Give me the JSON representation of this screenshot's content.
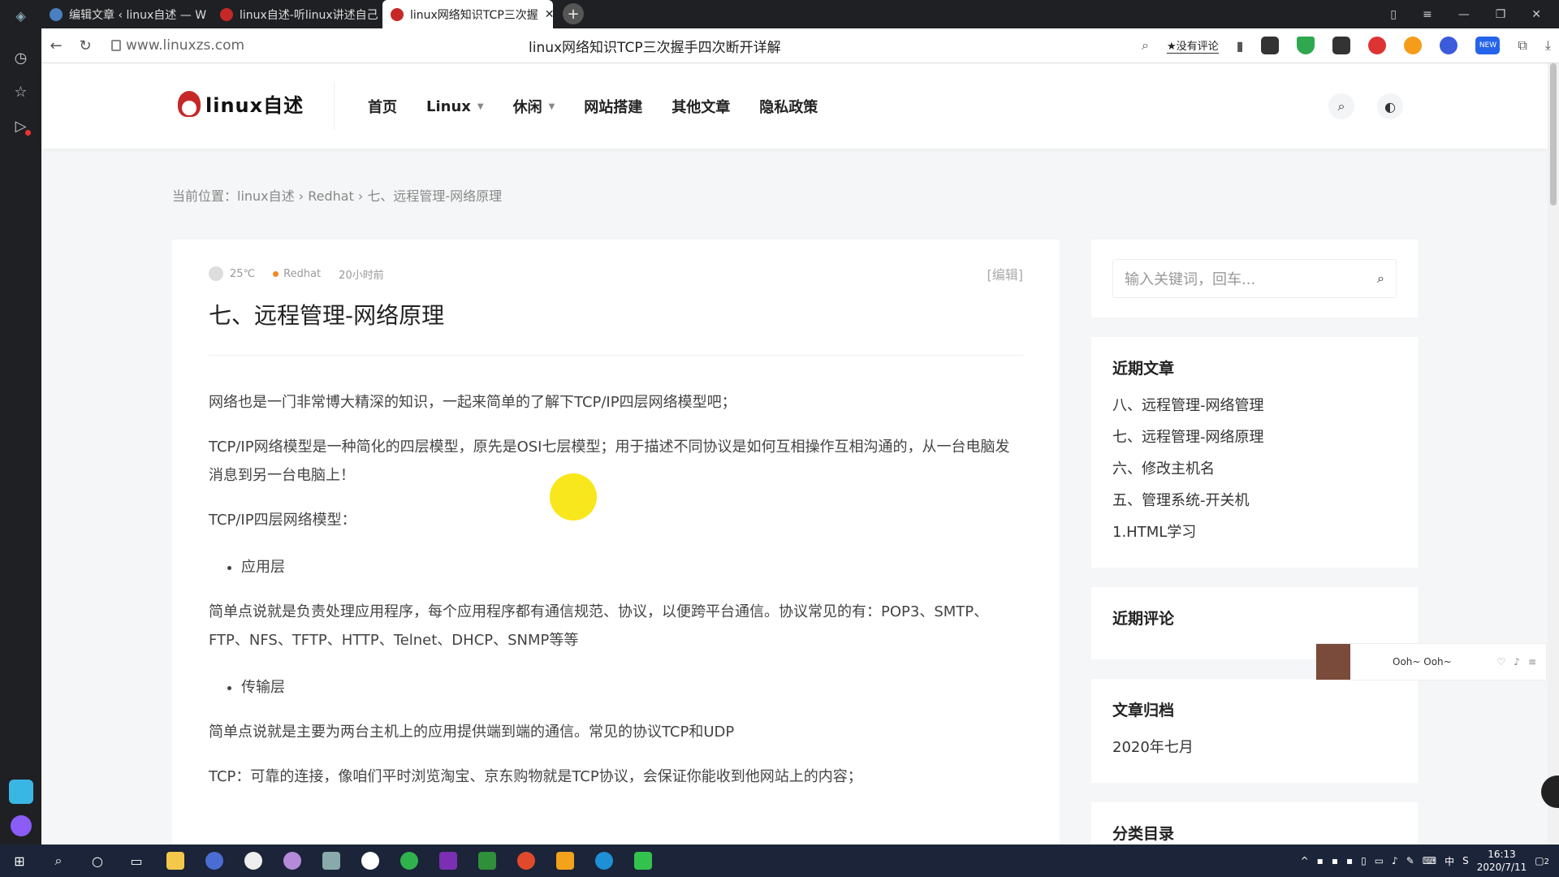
{
  "browser": {
    "tabs": [
      {
        "label": "编辑文章 ‹ linux自述 — W",
        "active": false
      },
      {
        "label": "linux自述-听linux讲述自己",
        "active": false
      },
      {
        "label": "linux网络知识TCP三次握",
        "active": true
      }
    ],
    "url": "www.linuxzs.com",
    "page_title": "linux网络知识TCP三次握手四次断开详解",
    "comment_button": "★没有评论",
    "new_badge": "NEW"
  },
  "site": {
    "logo_text": "linux自述",
    "nav": [
      {
        "label": "首页",
        "dropdown": false
      },
      {
        "label": "Linux",
        "dropdown": true
      },
      {
        "label": "休闲",
        "dropdown": true
      },
      {
        "label": "网站搭建",
        "dropdown": false
      },
      {
        "label": "其他文章",
        "dropdown": false
      },
      {
        "label": "隐私政策",
        "dropdown": false
      }
    ]
  },
  "breadcrumb": "当前位置：linux自述 › Redhat › 七、远程管理-网络原理",
  "article": {
    "author": "25℃",
    "category": "Redhat",
    "time": "20小时前",
    "edit": "[编辑]",
    "title": "七、远程管理-网络原理",
    "p1": "网络也是一门非常博大精深的知识，一起来简单的了解下TCP/IP四层网络模型吧；",
    "p2": "TCP/IP网络模型是一种简化的四层模型，原先是OSI七层模型；用于描述不同协议是如何互相操作互相沟通的，从一台电脑发消息到另一台电脑上！",
    "p3": "TCP/IP四层网络模型：",
    "li1": "应用层",
    "p4": "简单点说就是负责处理应用程序，每个应用程序都有通信规范、协议，以便跨平台通信。协议常见的有：POP3、SMTP、FTP、NFS、TFTP、HTTP、Telnet、DHCP、SNMP等等",
    "li2": "传输层",
    "p5": "简单点说就是主要为两台主机上的应用提供端到端的通信。常见的协议TCP和UDP",
    "p6": "TCP：可靠的连接，像咱们平时浏览淘宝、京东购物就是TCP协议，会保证你能收到他网站上的内容；"
  },
  "sidebar": {
    "search_placeholder": "输入关键词，回车...",
    "recent_posts_title": "近期文章",
    "recent_posts": [
      "八、远程管理-网络管理",
      "七、远程管理-网络原理",
      "六、修改主机名",
      "五、管理系统-开关机",
      "1.HTML学习"
    ],
    "recent_comments_title": "近期评论",
    "archives_title": "文章归档",
    "archives": [
      "2020年七月"
    ],
    "categories_title": "分类目录"
  },
  "music_player": {
    "song": "Ooh~ Ooh~"
  },
  "taskbar": {
    "time": "16:13",
    "date": "2020/7/11",
    "ime": "中",
    "notif_count": "2"
  }
}
